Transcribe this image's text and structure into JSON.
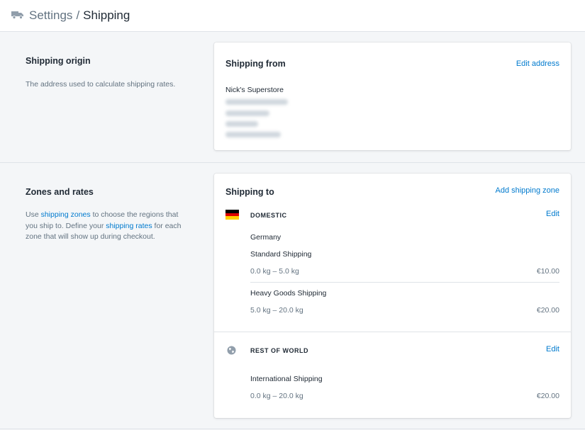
{
  "header": {
    "icon": "truck-icon",
    "parent": "Settings",
    "separator": "/",
    "current": "Shipping"
  },
  "origin_section": {
    "title": "Shipping origin",
    "description": "The address used to calculate shipping rates."
  },
  "origin_card": {
    "title": "Shipping from",
    "action": "Edit address",
    "store_name": "Nick's Superstore"
  },
  "zones_section": {
    "title": "Zones and rates",
    "desc_part1": "Use ",
    "desc_link1": "shipping zones",
    "desc_part2": " to choose the regions that you ship to. Define your ",
    "desc_link2": "shipping rates",
    "desc_part3": " for each zone that will show up during checkout."
  },
  "zones_card": {
    "title": "Shipping to",
    "action": "Add shipping zone",
    "zones": [
      {
        "name": "DOMESTIC",
        "icon": "germany-flag-icon",
        "edit": "Edit",
        "country": "Germany",
        "rates": [
          {
            "name": "Standard Shipping",
            "range": "0.0 kg – 5.0 kg",
            "price": "€10.00"
          },
          {
            "name": "Heavy Goods Shipping",
            "range": "5.0 kg – 20.0 kg",
            "price": "€20.00"
          }
        ]
      },
      {
        "name": "REST OF WORLD",
        "icon": "globe-icon",
        "edit": "Edit",
        "rates": [
          {
            "name": "International Shipping",
            "range": "0.0 kg – 20.0 kg",
            "price": "€20.00"
          }
        ]
      }
    ]
  },
  "colors": {
    "link": "#007ace",
    "background": "#f4f6f8",
    "text": "#212b36",
    "subdued": "#637381"
  }
}
